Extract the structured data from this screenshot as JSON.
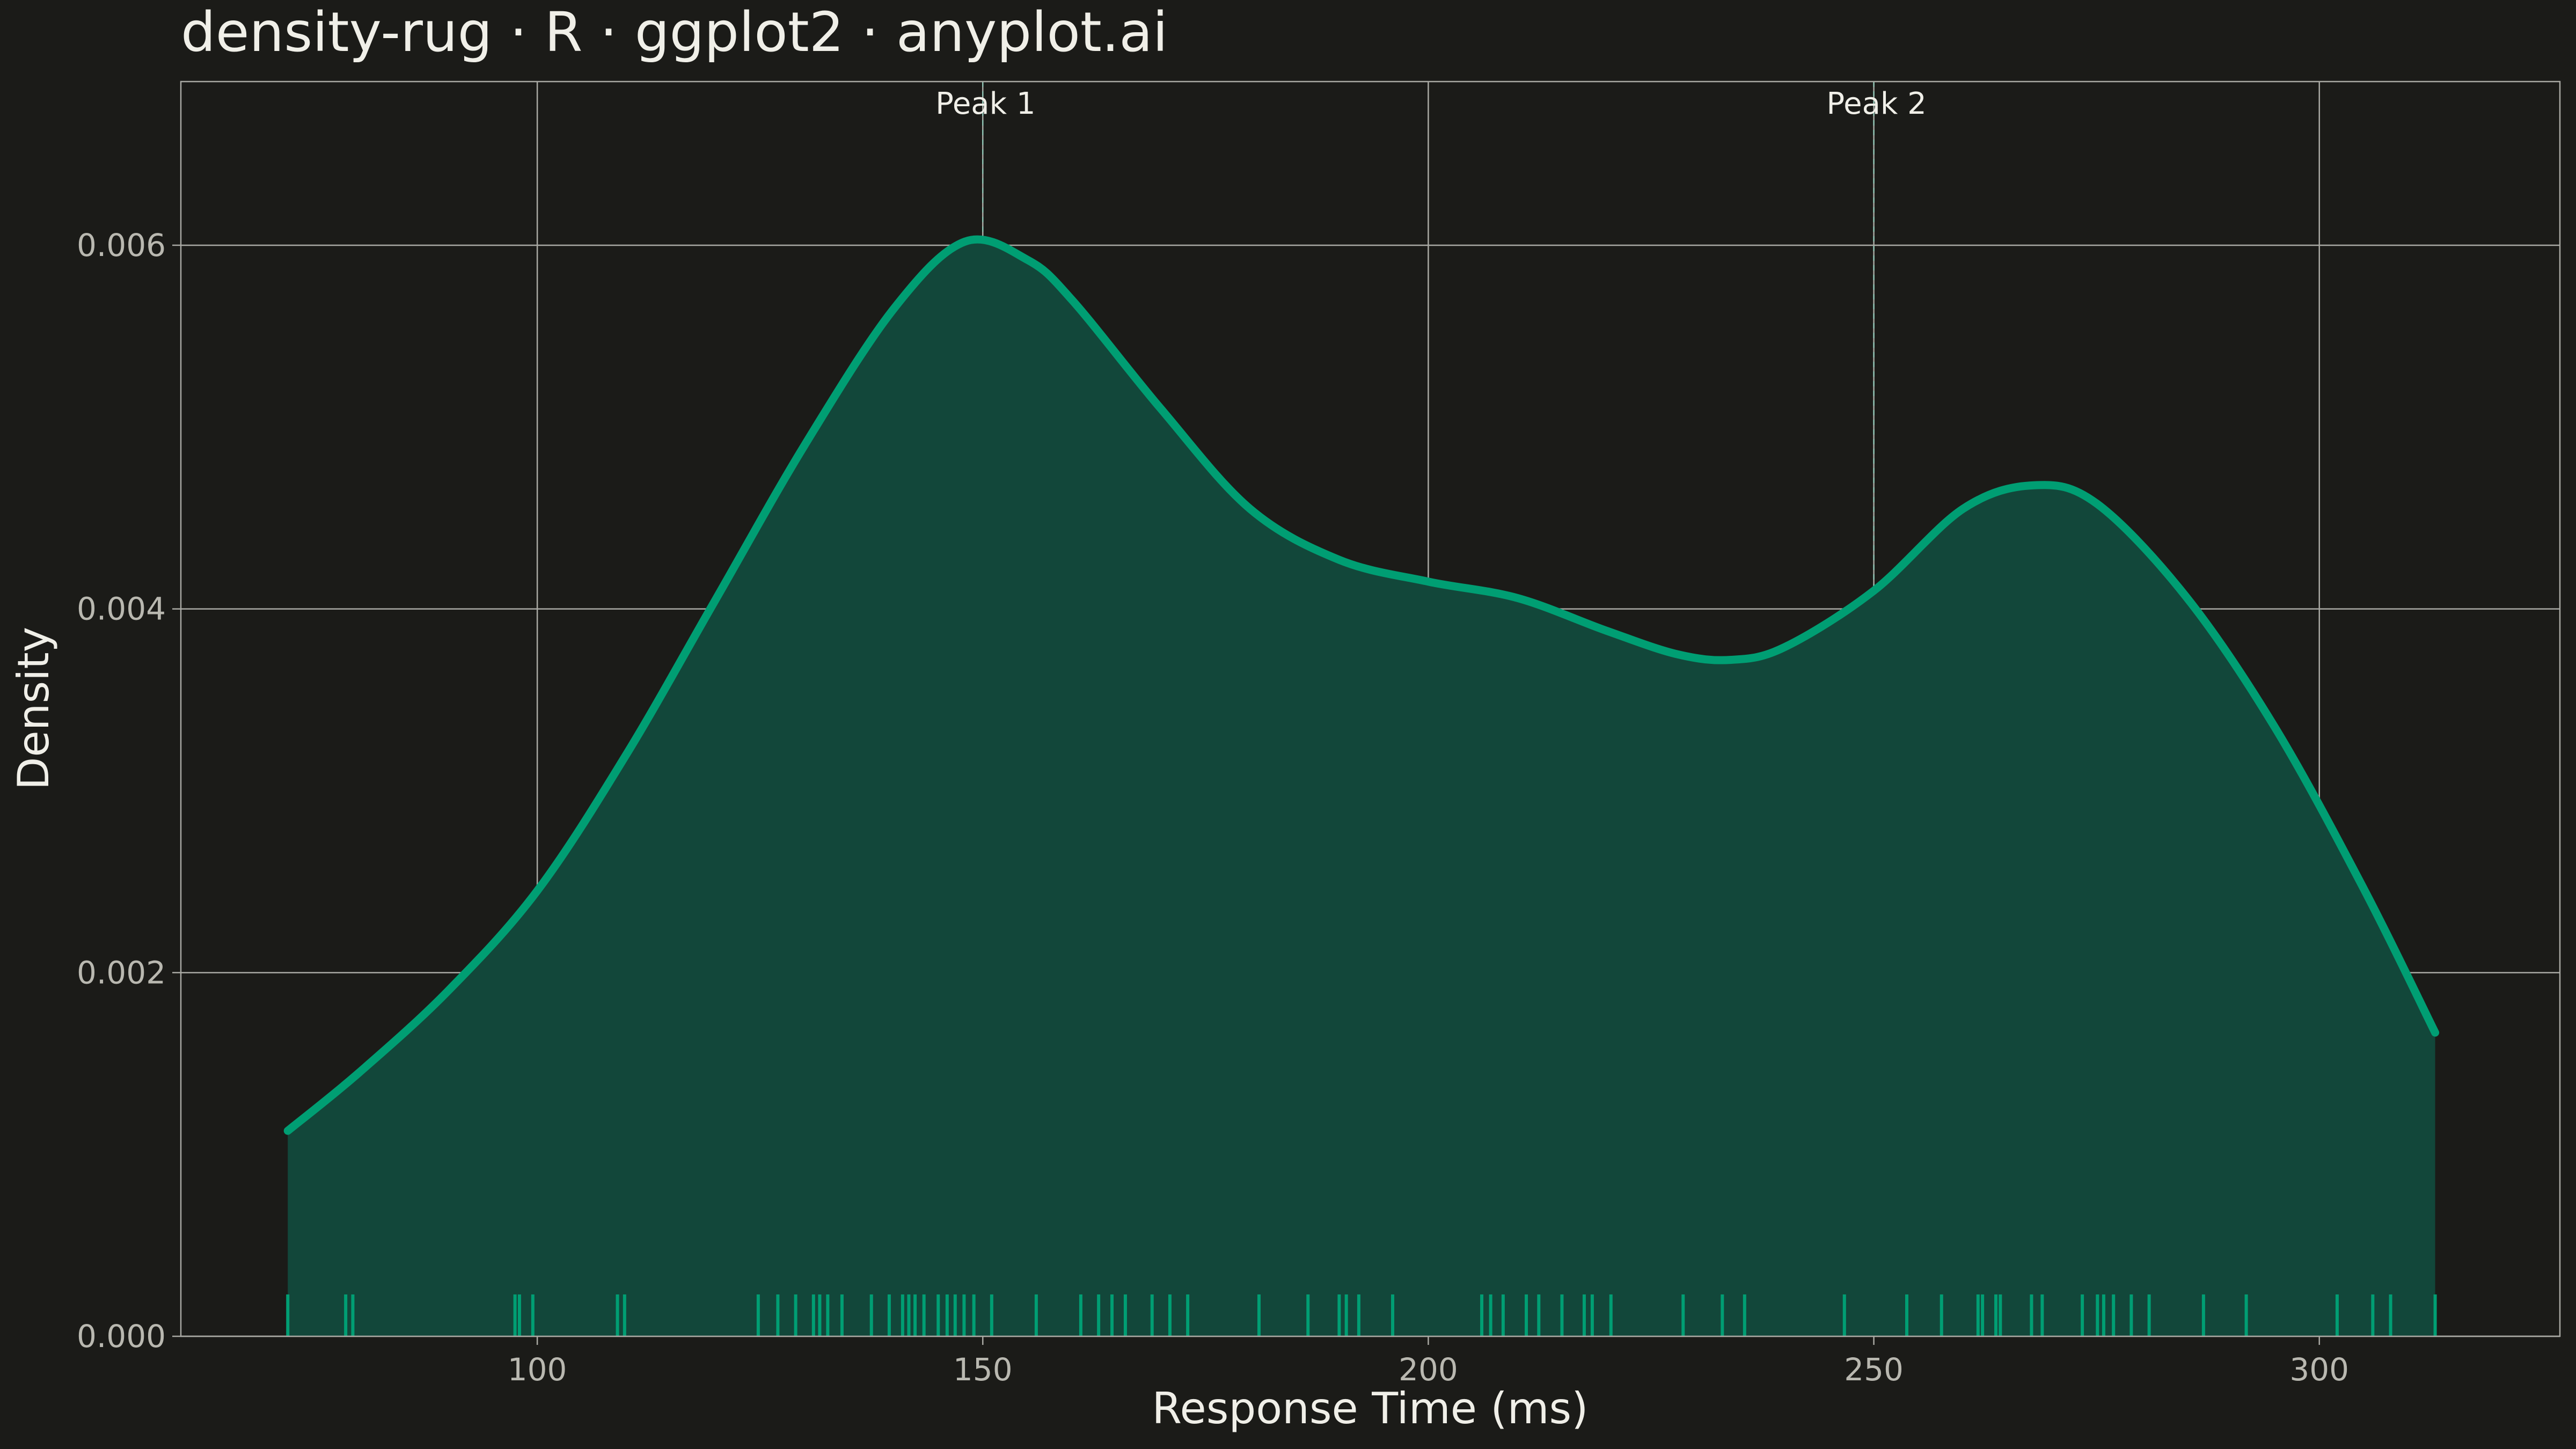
{
  "chart_data": {
    "type": "area",
    "title": "density-rug · R · ggplot2 · anyplot.ai",
    "xlabel": "Response Time (ms)",
    "ylabel": "Density",
    "xlim": [
      60,
      327
    ],
    "ylim": [
      0,
      0.0069
    ],
    "x_ticks": [
      100,
      150,
      200,
      250,
      300
    ],
    "y_ticks": [
      0,
      0.002,
      0.004,
      0.006
    ],
    "x_tick_labels": [
      "100",
      "150",
      "200",
      "250",
      "300"
    ],
    "y_tick_labels": [
      "0.000",
      "0.002",
      "0.004",
      "0.006"
    ],
    "grid": true,
    "colors": {
      "line": "#009e73",
      "fill": "#12473a",
      "rug": "#009e73",
      "background": "#1b1b18",
      "grid": "#a9a9a3"
    },
    "density": {
      "x": [
        72,
        80,
        90,
        100,
        110,
        120,
        130,
        140,
        148,
        155,
        160,
        170,
        180,
        190,
        200,
        210,
        220,
        228,
        234,
        240,
        250,
        260,
        268,
        275,
        285,
        295,
        305,
        313
      ],
      "y": [
        0.00113,
        0.00145,
        0.0019,
        0.00245,
        0.0032,
        0.00405,
        0.0049,
        0.00565,
        0.00602,
        0.00592,
        0.0057,
        0.0051,
        0.00455,
        0.00427,
        0.00415,
        0.00406,
        0.00388,
        0.00375,
        0.00372,
        0.00379,
        0.0041,
        0.00455,
        0.00468,
        0.00458,
        0.00407,
        0.00335,
        0.00246,
        0.00167
      ]
    },
    "rug": [
      72,
      78.5,
      79.3,
      97.5,
      98,
      99.5,
      109,
      109.8,
      124.8,
      127,
      129,
      131,
      131.7,
      132.6,
      134.2,
      137.5,
      139.5,
      141,
      141.7,
      142.4,
      143.4,
      145,
      146,
      146.9,
      147.9,
      149,
      151,
      156,
      161,
      163,
      164.5,
      166,
      169,
      171,
      173,
      181,
      186.5,
      190,
      190.8,
      192.2,
      196,
      206,
      207,
      208.4,
      211,
      212.4,
      215,
      217.5,
      218.4,
      220.5,
      228.6,
      233,
      235.5,
      246.7,
      253.7,
      257.6,
      261.7,
      262.2,
      263.7,
      264.2,
      267.7,
      268.9,
      273.4,
      275.1,
      275.8,
      276.9,
      278.9,
      280.9,
      287,
      291.8,
      302,
      306,
      308,
      313
    ],
    "annotations": [
      {
        "x": 150,
        "label": "Peak 1"
      },
      {
        "x": 250,
        "label": "Peak 2"
      }
    ]
  }
}
